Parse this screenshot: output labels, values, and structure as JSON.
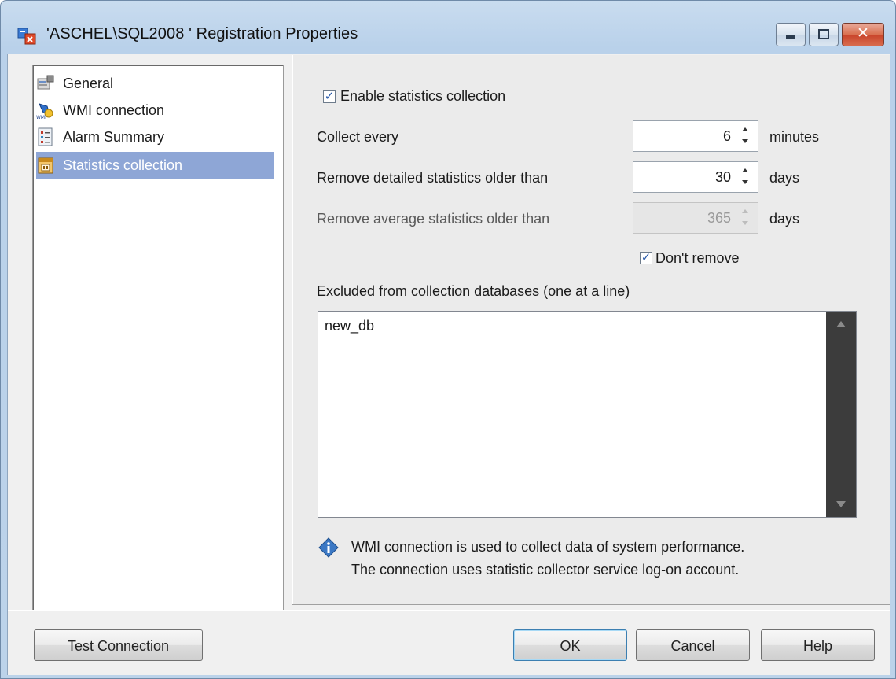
{
  "window": {
    "title": "'ASCHEL\\SQL2008 ' Registration Properties"
  },
  "nav": {
    "items": [
      {
        "label": "General",
        "icon": "general-properties-icon",
        "selected": false
      },
      {
        "label": "WMI connection",
        "icon": "wmi-icon",
        "selected": false
      },
      {
        "label": "Alarm Summary",
        "icon": "alarm-list-icon",
        "selected": false
      },
      {
        "label": "Statistics collection",
        "icon": "statistics-calendar-icon",
        "selected": true
      }
    ]
  },
  "statistics": {
    "enable_label": "Enable statistics collection",
    "enable_checked": true,
    "collect_label": "Collect every",
    "collect_value": "6",
    "collect_unit": "minutes",
    "detailed_label": "Remove detailed statistics older than",
    "detailed_value": "30",
    "detailed_unit": "days",
    "average_label": "Remove average statistics older than",
    "average_value": "365",
    "average_unit": "days",
    "average_enabled": false,
    "dont_remove_label": "Don't remove",
    "dont_remove_checked": true,
    "excluded_label": "Excluded from collection databases (one at a line)",
    "excluded_text": "new_db"
  },
  "info": {
    "line1": "WMI connection is used to collect data of system performance.",
    "line2": "The connection uses statistic collector service log-on account."
  },
  "buttons": {
    "test_connection": "Test Connection",
    "ok": "OK",
    "cancel": "Cancel",
    "help": "Help"
  },
  "colors": {
    "selection": "#8ea6d6",
    "titlebar": "#b9d1ea",
    "close_button": "#c8442a"
  }
}
